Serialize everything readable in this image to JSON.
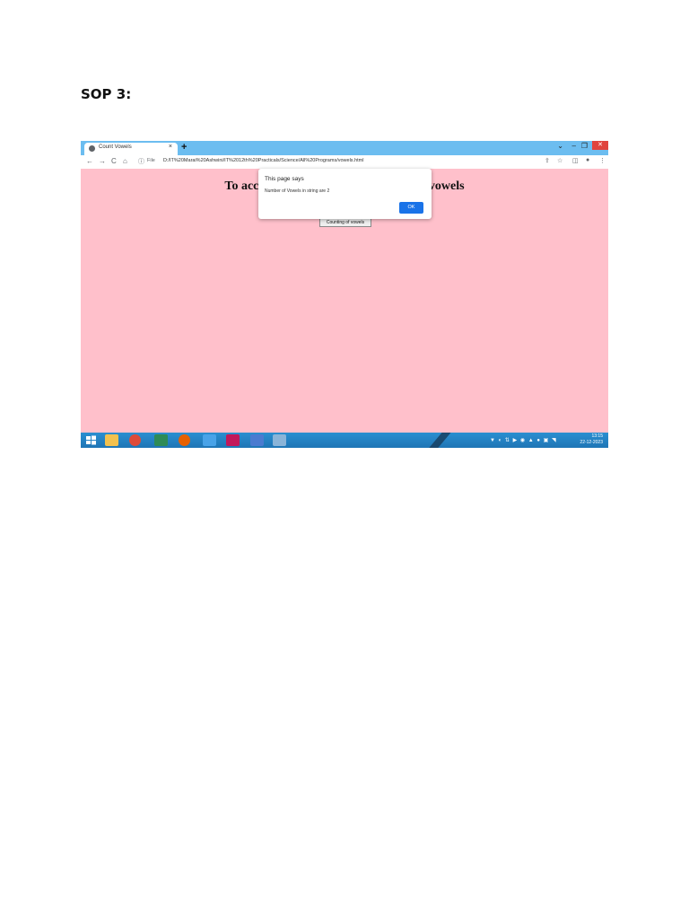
{
  "document": {
    "heading": "SOP 3:"
  },
  "browser": {
    "tab_title": "Count Vowels",
    "tab_close": "×",
    "new_tab": "+",
    "window_min": "⌄",
    "window_min2": "–",
    "window_max": "❐",
    "window_close": "✕",
    "nav_back": "←",
    "nav_forward": "→",
    "nav_reload": "C",
    "nav_home": "⌂",
    "omni_icon": "ⓘ",
    "omni_scheme": "File",
    "url": "D:/IT%20Marai%20Ashwini/IT%2012th%20Practicals/Science/All%20Programs/vowels.html",
    "toolbar_icons": [
      "⇪",
      "☆",
      "◫",
      "●",
      "⋮"
    ]
  },
  "page": {
    "title": "To accept string and count number of vowels",
    "button_label": "Counting of vowels"
  },
  "dialog": {
    "title": "This page says",
    "message": "Number of Vowels in string are 2",
    "ok_label": "OK"
  },
  "taskbar": {
    "tray_icons": "▼ ◐ ⇅ ▶ ◉ ▲ ● ▣ ◥",
    "time": "13:15",
    "date": "22-12-2023",
    "colors": {
      "start": "#ffffff",
      "explorer": "#f2c14e",
      "chrome": "#dd4b39",
      "store": "#2e8b57",
      "firefox": "#e66000",
      "ie": "#49a3e8",
      "wps": "#c2185b",
      "word": "#4a7bd0",
      "app": "#8ab4d8"
    }
  }
}
